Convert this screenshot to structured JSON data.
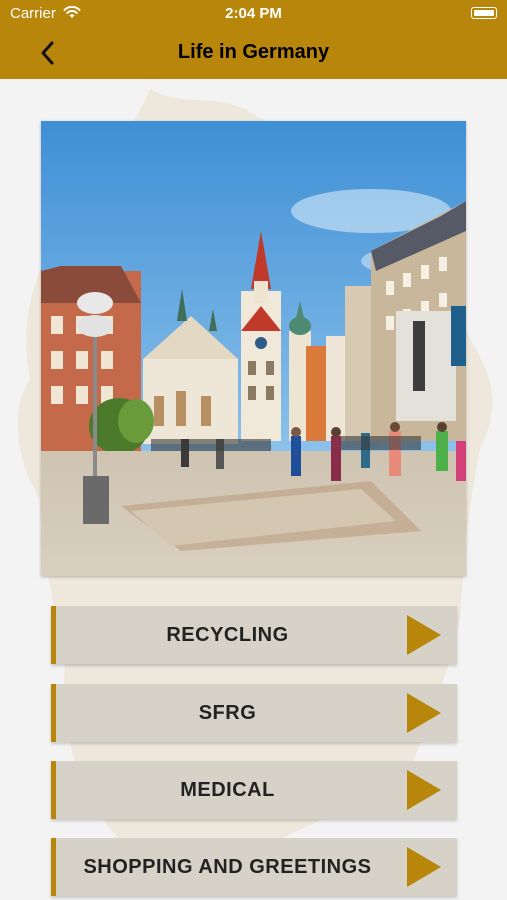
{
  "status_bar": {
    "carrier": "Carrier",
    "time": "2:04 PM"
  },
  "nav": {
    "title": "Life in Germany",
    "back_icon": "chevron-left-icon"
  },
  "colors": {
    "accent": "#b8860b",
    "button_bg": "#d6d2c8",
    "text": "#222222"
  },
  "menu": [
    {
      "label": "RECYCLING"
    },
    {
      "label": "SFRG"
    },
    {
      "label": "MEDICAL"
    },
    {
      "label": "SHOPPING AND GREETINGS"
    }
  ]
}
